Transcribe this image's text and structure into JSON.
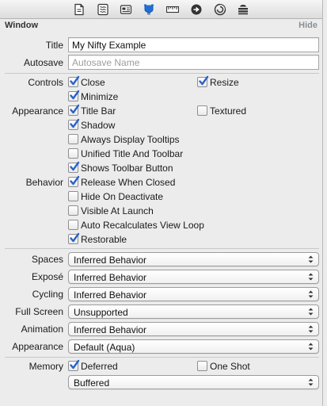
{
  "toolbar": {
    "icons": [
      "file-inspector-icon",
      "quick-help-icon",
      "identity-icon",
      "attributes-icon",
      "size-icon",
      "connections-icon",
      "bindings-icon",
      "effects-icon"
    ],
    "selected_color": "#1f6fd6"
  },
  "header": {
    "title": "Window",
    "hide_label": "Hide"
  },
  "title_field": {
    "label": "Title",
    "value": "My Nifty Example"
  },
  "autosave_field": {
    "label": "Autosave",
    "placeholder": "Autosave Name"
  },
  "controls": {
    "label": "Controls",
    "close": {
      "label": "Close",
      "checked": true
    },
    "resize": {
      "label": "Resize",
      "checked": true
    },
    "minimize": {
      "label": "Minimize",
      "checked": true
    }
  },
  "appearance": {
    "label": "Appearance",
    "title_bar": {
      "label": "Title Bar",
      "checked": true
    },
    "textured": {
      "label": "Textured",
      "checked": false
    },
    "shadow": {
      "label": "Shadow",
      "checked": true
    },
    "tooltips": {
      "label": "Always Display Tooltips",
      "checked": false
    },
    "unified": {
      "label": "Unified Title And Toolbar",
      "checked": false
    },
    "toolbar_button": {
      "label": "Shows Toolbar Button",
      "checked": true
    }
  },
  "behavior": {
    "label": "Behavior",
    "release": {
      "label": "Release When Closed",
      "checked": true
    },
    "hide_deactivate": {
      "label": "Hide On Deactivate",
      "checked": false
    },
    "visible_launch": {
      "label": "Visible At Launch",
      "checked": false
    },
    "auto_recalc": {
      "label": "Auto Recalculates View Loop",
      "checked": false
    },
    "restorable": {
      "label": "Restorable",
      "checked": true
    }
  },
  "popups": {
    "spaces": {
      "label": "Spaces",
      "value": "Inferred Behavior"
    },
    "expose": {
      "label": "Exposé",
      "value": "Inferred Behavior"
    },
    "cycling": {
      "label": "Cycling",
      "value": "Inferred Behavior"
    },
    "fullscreen": {
      "label": "Full Screen",
      "value": "Unsupported"
    },
    "animation": {
      "label": "Animation",
      "value": "Inferred Behavior"
    },
    "appearance": {
      "label": "Appearance",
      "value": "Default (Aqua)"
    }
  },
  "memory": {
    "label": "Memory",
    "deferred": {
      "label": "Deferred",
      "checked": true
    },
    "one_shot": {
      "label": "One Shot",
      "checked": false
    },
    "backing": {
      "value": "Buffered"
    }
  },
  "colors": {
    "check_blue": "#2a62c9",
    "hide_gray": "#8a8f96"
  }
}
